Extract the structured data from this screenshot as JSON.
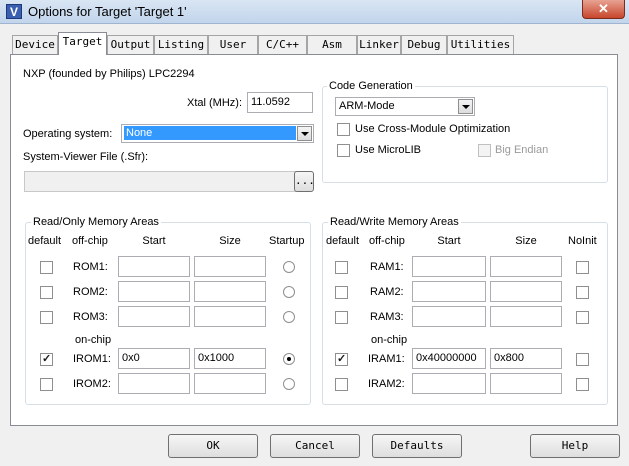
{
  "window": {
    "title": "Options for Target 'Target 1'",
    "close_glyph": "✕",
    "app_icon_glyph": "V"
  },
  "tabs": [
    "Device",
    "Target",
    "Output",
    "Listing",
    "User",
    "C/C++",
    "Asm",
    "Linker",
    "Debug",
    "Utilities"
  ],
  "active_tab": "Target",
  "device": {
    "name": "NXP (founded by Philips) LPC2294"
  },
  "xtal": {
    "label": "Xtal (MHz):",
    "value": "11.0592"
  },
  "os": {
    "label": "Operating system:",
    "value": "None"
  },
  "sysviewer": {
    "label": "System-Viewer File (.Sfr):",
    "value": "",
    "browse": "..."
  },
  "codegen": {
    "title": "Code Generation",
    "mode": "ARM-Mode",
    "cross_module": {
      "label": "Use Cross-Module Optimization",
      "checked": false
    },
    "microlib": {
      "label": "Use MicroLIB",
      "checked": false
    },
    "big_endian": {
      "label": "Big Endian",
      "checked": false,
      "disabled": true
    }
  },
  "rom": {
    "title": "Read/Only Memory Areas",
    "headers": {
      "default": "default",
      "offchip": "off-chip",
      "start": "Start",
      "size": "Size",
      "startup": "Startup"
    },
    "onchip_label": "on-chip",
    "rows": [
      {
        "label": "ROM1:",
        "default": false,
        "start": "",
        "size": "",
        "startup": false
      },
      {
        "label": "ROM2:",
        "default": false,
        "start": "",
        "size": "",
        "startup": false
      },
      {
        "label": "ROM3:",
        "default": false,
        "start": "",
        "size": "",
        "startup": false
      },
      {
        "label": "IROM1:",
        "default": true,
        "start": "0x0",
        "size": "0x1000",
        "startup": true
      },
      {
        "label": "IROM2:",
        "default": false,
        "start": "",
        "size": "",
        "startup": false
      }
    ]
  },
  "ram": {
    "title": "Read/Write Memory Areas",
    "headers": {
      "default": "default",
      "offchip": "off-chip",
      "start": "Start",
      "size": "Size",
      "noinit": "NoInit"
    },
    "onchip_label": "on-chip",
    "rows": [
      {
        "label": "RAM1:",
        "default": false,
        "start": "",
        "size": "",
        "noinit": false
      },
      {
        "label": "RAM2:",
        "default": false,
        "start": "",
        "size": "",
        "noinit": false
      },
      {
        "label": "RAM3:",
        "default": false,
        "start": "",
        "size": "",
        "noinit": false
      },
      {
        "label": "IRAM1:",
        "default": true,
        "start": "0x40000000",
        "size": "0x800",
        "noinit": false
      },
      {
        "label": "IRAM2:",
        "default": false,
        "start": "",
        "size": "",
        "noinit": false
      }
    ]
  },
  "buttons": {
    "ok": "OK",
    "cancel": "Cancel",
    "defaults": "Defaults",
    "help": "Help"
  }
}
